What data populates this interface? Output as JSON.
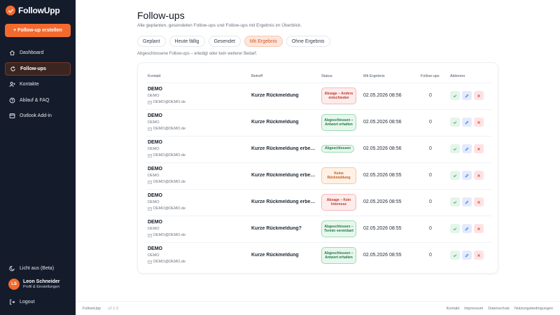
{
  "app": {
    "logo_text": "FollowUpp",
    "create_button_label": "+ Follow-up erstellen",
    "accent_color": "#f26a2e"
  },
  "sidebar": {
    "items": [
      {
        "label": "Dashboard",
        "icon": "home-icon"
      },
      {
        "label": "Follow-ups",
        "icon": "refresh-icon",
        "active": true
      },
      {
        "label": "Kontakte",
        "icon": "user-plus-icon"
      },
      {
        "label": "Ablauf & FAQ",
        "icon": "help-circle-icon"
      },
      {
        "label": "Outlook Add-in",
        "icon": "mail-window-icon"
      }
    ],
    "theme_label": "Licht aus (Beta)",
    "user": {
      "initials": "LS",
      "name": "Leon Schneider",
      "subtitle": "Profil & Einstellungen"
    },
    "logout_label": "Logout"
  },
  "main": {
    "title": "Follow-ups",
    "subtitle": "Alle geplanten, gesendeten Follow-ups und Follow-ups mit Ergebnis im Überblick.",
    "tabs": [
      {
        "label": "Geplant"
      },
      {
        "label": "Heute fällig"
      },
      {
        "label": "Gesendet"
      },
      {
        "label": "Mit Ergebnis",
        "active": true
      },
      {
        "label": "Ohne Ergebnis"
      }
    ],
    "filter_hint": "Abgeschlossene Follow-ups – erledigt oder kein weiterer Bedarf.",
    "table": {
      "columns": [
        "Kontakt",
        "Betreff",
        "Status",
        "Mit Ergebnis",
        "Follow-ups",
        "Aktionen"
      ],
      "rows": [
        {
          "name": "DEMO",
          "company": "DEMO",
          "email": "DEMO@DEMO.de",
          "subject": "Kurze Rückmeldung",
          "status": "Absage – Anders entschieden",
          "status_tone": "red",
          "date": "02.05.2026 08:56",
          "followups": "0"
        },
        {
          "name": "DEMO",
          "company": "DEMO",
          "email": "DEMO@DEMO.de",
          "subject": "Kurze Rückmeldung",
          "status": "Abgeschlossen – Antwort erhalten",
          "status_tone": "green",
          "date": "02.05.2026 08:56",
          "followups": "0"
        },
        {
          "name": "DEMO",
          "company": "DEMO",
          "email": "DEMO@DEMO.de",
          "subject": "Kurze Rückmeldung erbeten",
          "status": "Abgeschlossen",
          "status_tone": "green",
          "date": "02.05.2026 08:56",
          "followups": "0"
        },
        {
          "name": "DEMO",
          "company": "DEMO",
          "email": "DEMO@DEMO.de",
          "subject": "Kurze Rückmeldung erbeten",
          "status": "Keine Rückmeldung",
          "status_tone": "orange",
          "date": "02.05.2026 08:55",
          "followups": "0"
        },
        {
          "name": "DEMO",
          "company": "DEMO",
          "email": "DEMO@DEMO.de",
          "subject": "Kurze Rückmeldung erbeten",
          "status": "Absage – Kein Interesse",
          "status_tone": "red",
          "date": "02.05.2026 08:55",
          "followups": "0"
        },
        {
          "name": "DEMO",
          "company": "DEMO",
          "email": "DEMO@DEMO.de",
          "subject": "Kurze Rückmeldung?",
          "status": "Abgeschlossen – Termin vereinbart",
          "status_tone": "green",
          "date": "02.05.2026 08:55",
          "followups": "0"
        },
        {
          "name": "DEMO",
          "company": "DEMO",
          "email": "DEMO@DEMO.de",
          "subject": "Kurze Rückmeldung",
          "status": "Abgeschlossen – Antwort erhalten",
          "status_tone": "green",
          "date": "02.05.2026 08:55",
          "followups": "0"
        }
      ]
    }
  },
  "footer": {
    "brand": "FollowUpp",
    "version": "v2.1.3",
    "links": [
      "Kontakt",
      "Impressum",
      "Datenschutz",
      "Nutzungsbedingungen"
    ]
  }
}
